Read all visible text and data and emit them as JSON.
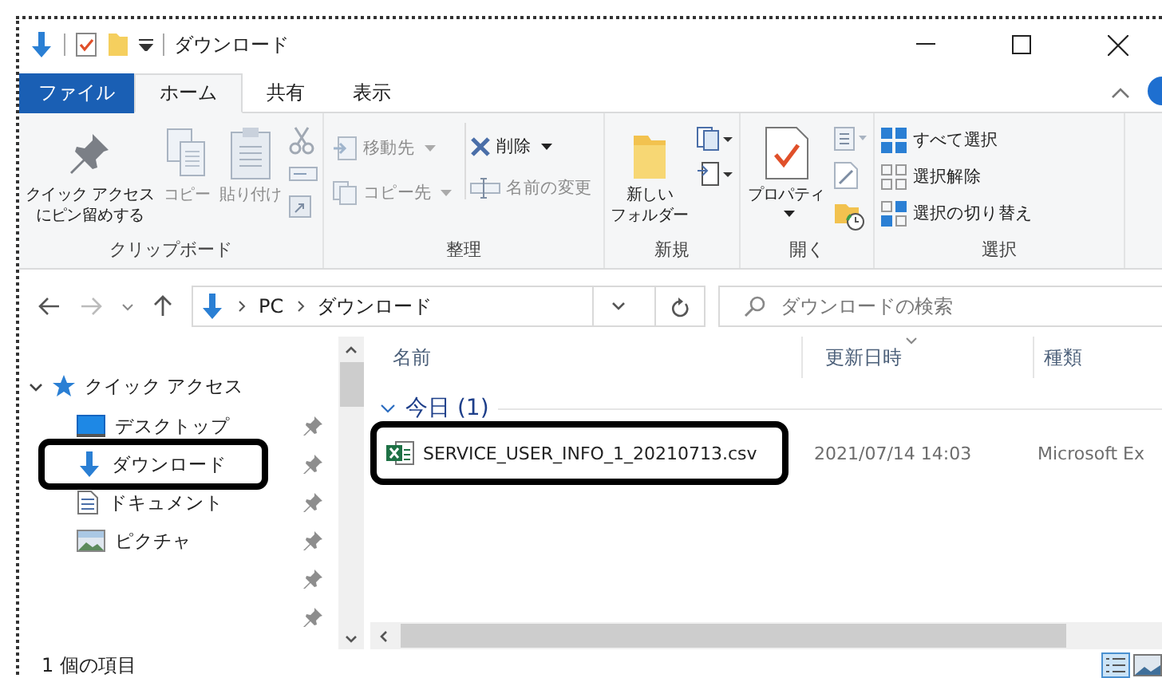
{
  "window": {
    "title": "ダウンロード"
  },
  "ribbon_tabs": [
    {
      "label": "ファイル",
      "kind": "file",
      "selected": false
    },
    {
      "label": "ホーム",
      "kind": "tab",
      "selected": true
    },
    {
      "label": "共有",
      "kind": "tab",
      "selected": false
    },
    {
      "label": "表示",
      "kind": "tab",
      "selected": false
    }
  ],
  "ribbon_groups": [
    {
      "kind": "clipboard",
      "label": "クリップボード",
      "buttons": [
        {
          "lines": [
            "クイック アクセス",
            "にピン留めする"
          ],
          "disabled": false
        },
        {
          "lines": [
            "コピー"
          ],
          "disabled": true
        },
        {
          "lines": [
            "貼り付け"
          ],
          "disabled": true
        }
      ]
    },
    {
      "kind": "organize",
      "label": "整理",
      "buttons": [
        {
          "label": "移動先",
          "disabled": true,
          "dropdown": true
        },
        {
          "label": "コピー先",
          "disabled": true,
          "dropdown": true
        },
        {
          "label": "削除",
          "disabled": false,
          "dropdown": true
        },
        {
          "label": "名前の変更",
          "disabled": true,
          "dropdown": false
        }
      ]
    },
    {
      "kind": "new",
      "label": "新規",
      "buttons": [
        {
          "lines": [
            "新しい",
            "フォルダー"
          ],
          "disabled": false
        }
      ]
    },
    {
      "kind": "open",
      "label": "開く",
      "buttons": [
        {
          "lines": [
            "プロパティ"
          ],
          "disabled": false,
          "dropdown": true
        }
      ]
    },
    {
      "kind": "select",
      "label": "選択",
      "buttons": [
        {
          "label": "すべて選択",
          "disabled": false
        },
        {
          "label": "選択解除",
          "disabled": false
        },
        {
          "label": "選択の切り替え",
          "disabled": false
        }
      ]
    }
  ],
  "address": {
    "path": [
      "PC",
      "ダウンロード"
    ],
    "search": {
      "placeholder": "ダウンロードの検索"
    }
  },
  "nav_pane": {
    "items": [
      {
        "label": "クイック アクセス",
        "expanded": true,
        "children": [
          {
            "label": "デスクトップ",
            "kind": "desktop",
            "pinned": true,
            "highlighted": false
          },
          {
            "label": "ダウンロード",
            "kind": "downloads",
            "pinned": true,
            "highlighted": true
          },
          {
            "label": "ドキュメント",
            "kind": "documents",
            "pinned": true,
            "highlighted": false
          },
          {
            "label": "ピクチャ",
            "kind": "pictures",
            "pinned": true,
            "highlighted": false
          },
          {
            "kind": "blank",
            "pinned": true
          },
          {
            "kind": "blank",
            "pinned": true
          }
        ]
      }
    ]
  },
  "columns": [
    {
      "label": "名前",
      "sorted": false
    },
    {
      "label": "更新日時",
      "sorted": true
    },
    {
      "label": "種類",
      "sorted": false
    }
  ],
  "groups": [
    {
      "label": "今日 (1)",
      "expanded": true,
      "rows": [
        {
          "name": "SERVICE_USER_INFO_1_20210713.csv",
          "modified": "2021/07/14 14:03",
          "type": "Microsoft Ex",
          "highlighted": true
        }
      ]
    }
  ],
  "status_bar": {
    "count": "1 個の項目"
  }
}
